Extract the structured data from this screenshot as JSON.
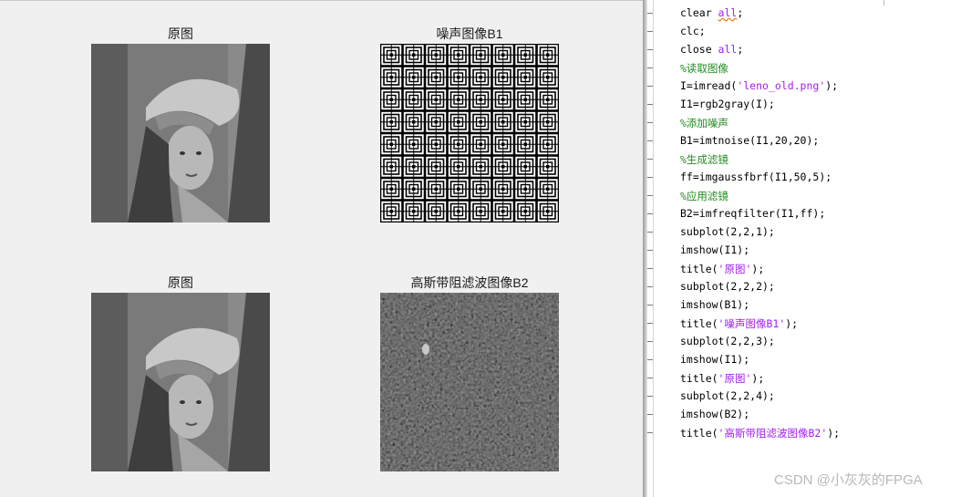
{
  "figure": {
    "subplots": [
      {
        "title": "原图",
        "image": "lena-grayscale"
      },
      {
        "title": "噪声图像B1",
        "image": "periodic-noise-pattern"
      },
      {
        "title": "原图",
        "image": "lena-grayscale"
      },
      {
        "title": "高斯带阻滤波图像B2",
        "image": "filtered-dark-noise"
      }
    ]
  },
  "editor": {
    "lines": [
      [
        {
          "t": "clear "
        },
        {
          "t": "all",
          "c": "kw-str squiggle"
        },
        {
          "t": ";"
        }
      ],
      [
        {
          "t": "clc;"
        }
      ],
      [
        {
          "t": "close "
        },
        {
          "t": "all",
          "c": "kw-str"
        },
        {
          "t": ";"
        }
      ],
      [
        {
          "t": "%读取图像",
          "c": "comment"
        }
      ],
      [
        {
          "t": "I=imread("
        },
        {
          "t": "'leno_old.png'",
          "c": "kw-str"
        },
        {
          "t": ");"
        }
      ],
      [
        {
          "t": "I1=rgb2gray(I);"
        }
      ],
      [
        {
          "t": "%添加噪声",
          "c": "comment"
        }
      ],
      [
        {
          "t": "B1=imtnoise(I1,20,20);"
        }
      ],
      [
        {
          "t": "%生成滤镜",
          "c": "comment"
        }
      ],
      [
        {
          "t": "ff=imgaussfbrf(I1,50,5);"
        }
      ],
      [
        {
          "t": "%应用滤镜",
          "c": "comment"
        }
      ],
      [
        {
          "t": "B2=imfreqfilter(I1,ff);"
        }
      ],
      [
        {
          "t": "subplot(2,2,1);"
        }
      ],
      [
        {
          "t": "imshow(I1);"
        }
      ],
      [
        {
          "t": "title("
        },
        {
          "t": "'原图'",
          "c": "kw-str"
        },
        {
          "t": ");"
        }
      ],
      [
        {
          "t": "subplot(2,2,2);"
        }
      ],
      [
        {
          "t": "imshow(B1);"
        }
      ],
      [
        {
          "t": "title("
        },
        {
          "t": "'噪声图像B1'",
          "c": "kw-str"
        },
        {
          "t": ");"
        }
      ],
      [
        {
          "t": "subplot(2,2,3);"
        }
      ],
      [
        {
          "t": "imshow(I1);"
        }
      ],
      [
        {
          "t": "title("
        },
        {
          "t": "'原图'",
          "c": "kw-str"
        },
        {
          "t": ");"
        }
      ],
      [
        {
          "t": "subplot(2,2,4);"
        }
      ],
      [
        {
          "t": "imshow(B2);"
        }
      ],
      [
        {
          "t": "title("
        },
        {
          "t": "'高斯带阻滤波图像B2'",
          "c": "kw-str"
        },
        {
          "t": ");"
        }
      ]
    ]
  },
  "watermark": "CSDN @小灰灰的FPGA",
  "colors": {
    "string": "#a020f0",
    "comment": "#228b22",
    "figure_bg": "#f0f0f0"
  }
}
